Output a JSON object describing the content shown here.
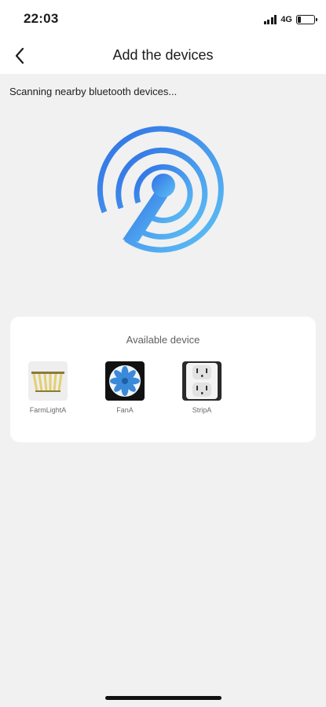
{
  "status_bar": {
    "time": "22:03",
    "network": "4G",
    "icons": [
      "signal-icon",
      "battery-icon"
    ],
    "battery_level": 0.2
  },
  "header": {
    "title": "Add the devices",
    "back_icon": "chevron-left-icon"
  },
  "scan": {
    "status_text": "Scanning nearby bluetooth devices...",
    "icon": "bluetooth-scan-radar-icon",
    "colors": {
      "gradient_start": "#2f6fe4",
      "gradient_end": "#5ec1f5"
    }
  },
  "available": {
    "title": "Available device",
    "devices": [
      {
        "name": "FarmLightA",
        "icon": "grow-light-icon"
      },
      {
        "name": "FanA",
        "icon": "fan-icon"
      },
      {
        "name": "StripA",
        "icon": "power-strip-icon"
      }
    ]
  }
}
